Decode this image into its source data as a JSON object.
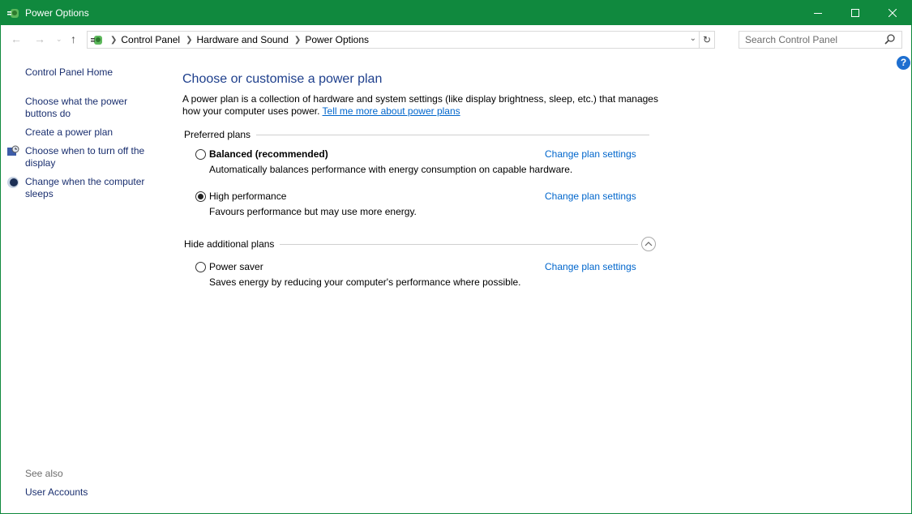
{
  "window": {
    "title": "Power Options",
    "controls": {
      "minimize": "minimize",
      "maximize": "maximize",
      "close": "close"
    }
  },
  "nav": {
    "breadcrumb": [
      "Control Panel",
      "Hardware and Sound",
      "Power Options"
    ],
    "search_placeholder": "Search Control Panel"
  },
  "sidebar": {
    "items": [
      {
        "label": "Control Panel Home"
      },
      {
        "label": "Choose what the power buttons do"
      },
      {
        "label": "Create a power plan"
      },
      {
        "label": "Choose when to turn off the display",
        "icon": "display-clock-icon"
      },
      {
        "label": "Change when the computer sleeps",
        "icon": "moon-icon"
      }
    ],
    "see_also_label": "See also",
    "see_also": [
      {
        "label": "User Accounts"
      }
    ]
  },
  "main": {
    "heading": "Choose or customise a power plan",
    "description": "A power plan is a collection of hardware and system settings (like display brightness, sleep, etc.) that manages how your computer uses power.",
    "learn_more_link": "Tell me more about power plans",
    "preferred_label": "Preferred plans",
    "additional_label": "Hide additional plans",
    "change_link": "Change plan settings",
    "plans": [
      {
        "name": "Balanced (recommended)",
        "description": "Automatically balances performance with energy consumption on capable hardware.",
        "selected": false
      },
      {
        "name": "High performance",
        "description": "Favours performance but may use more energy.",
        "selected": true
      },
      {
        "name": "Power saver",
        "description": "Saves energy by reducing your computer's performance where possible.",
        "selected": false
      }
    ]
  },
  "colors": {
    "titlebar": "#10893e",
    "link": "#0066cc",
    "heading": "#1e3f8c",
    "sidebar_link": "#1a2f6f"
  }
}
